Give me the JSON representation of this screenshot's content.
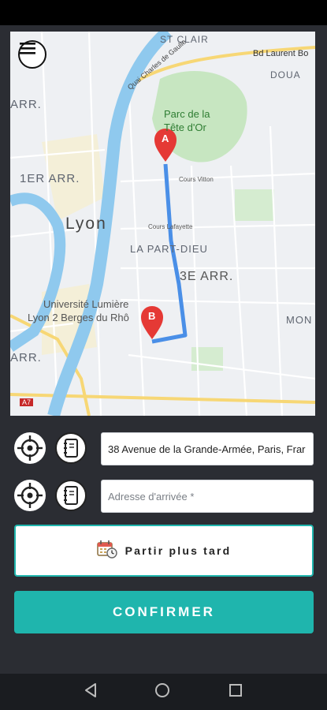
{
  "map": {
    "labels": {
      "st_clair": "ST CLAIR",
      "bd_laurent": "Bd Laurent Bo",
      "quai_de_gaulle": "Quai Charles de Gaulle",
      "douai": "DOUA",
      "parc": "Parc de la",
      "tete": "Tête d'Or",
      "arr1": "1ER ARR.",
      "arr_left_top": "ARR.",
      "lyon": "Lyon",
      "part_dieu": "LA PART-DIEU",
      "arr3": "3E ARR.",
      "univ1": "Université Lumière",
      "univ2": "Lyon 2 Berges du Rhô",
      "arr_left_bottom": "ARR.",
      "mon": "MON",
      "cours_lafayette": "Cours Lafayette",
      "cours_vitton": "Cours Vitton",
      "a7": "A7"
    },
    "marker_a": "A",
    "marker_b": "B",
    "menu_icon": "hamburger-menu-icon"
  },
  "departure": {
    "value": "38 Avenue de la Grande-Armée, Paris, Frar",
    "locate_icon": "crosshair-icon",
    "book_icon": "address-book-icon"
  },
  "arrival": {
    "placeholder": "Adresse d'arrivée *",
    "locate_icon": "crosshair-icon",
    "book_icon": "address-book-icon"
  },
  "later_button": {
    "label": "Partir plus tard",
    "icon": "calendar-clock-icon"
  },
  "confirm_button": {
    "label": "CONFIRMER"
  },
  "colors": {
    "accent": "#1fb5ad",
    "route": "#4a8fe7",
    "marker": "#e53935",
    "river": "#8fc9ee",
    "park": "#c7e6c1"
  }
}
